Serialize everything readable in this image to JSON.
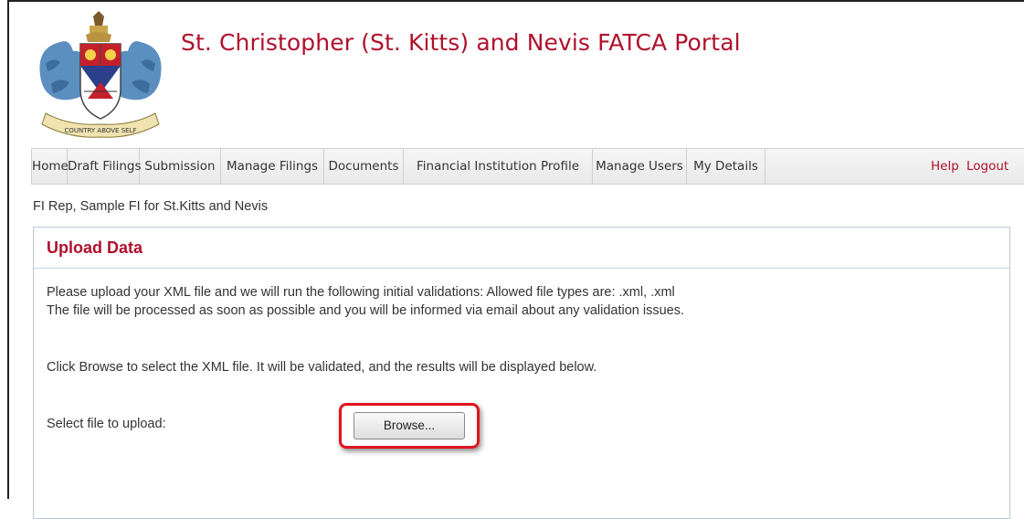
{
  "header": {
    "title": "St. Christopher (St. Kitts) and Nevis FATCA Portal",
    "logo_icon": "coat-of-arms-icon",
    "logo_motto": "COUNTRY ABOVE SELF"
  },
  "nav": {
    "items": [
      {
        "label": "Home"
      },
      {
        "label": "Draft Filings"
      },
      {
        "label": "Submission"
      },
      {
        "label": "Manage Filings"
      },
      {
        "label": "Documents"
      },
      {
        "label": "Financial Institution Profile"
      },
      {
        "label": "Manage Users"
      },
      {
        "label": "My Details"
      }
    ],
    "help_label": "Help",
    "logout_label": "Logout"
  },
  "user_line": "FI Rep, Sample FI for St.Kitts and Nevis",
  "upload": {
    "title": "Upload Data",
    "line1": "Please upload your XML file and we will run the following initial validations: Allowed file types are: .xml, .xml",
    "line2": "The file will be processed as soon as possible and you will be informed via email about any validation issues.",
    "instructions": "Click Browse to select the XML file. It will be validated, and the results will be displayed below.",
    "select_label": "Select file to upload:",
    "browse_label": "Browse..."
  },
  "colors": {
    "brand_red": "#b0102c",
    "highlight_red": "#e0141e",
    "panel_border": "#b9c8d6"
  }
}
